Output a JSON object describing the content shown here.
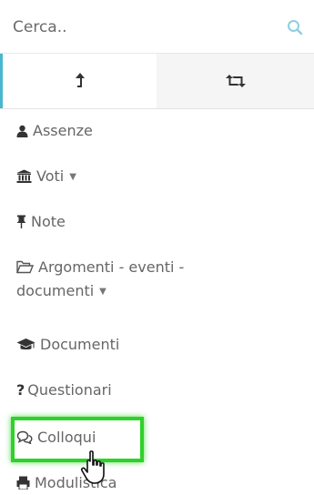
{
  "search": {
    "placeholder": "Cerca.."
  },
  "tabs": [
    {
      "icon": "upload-arrow-icon",
      "active": true
    },
    {
      "icon": "retweet-icon",
      "active": false
    }
  ],
  "menu": {
    "assenze": "Assenze",
    "voti": "Voti",
    "note": "Note",
    "argomenti_line1": "Argomenti - eventi -",
    "argomenti_line2": "documenti",
    "documenti": "Documenti",
    "questionari": "Questionari",
    "colloqui": "Colloqui",
    "modulistica": "Modulistica"
  },
  "colors": {
    "accent": "#49b6cf",
    "highlight": "#2fd12a",
    "text": "#666666"
  }
}
